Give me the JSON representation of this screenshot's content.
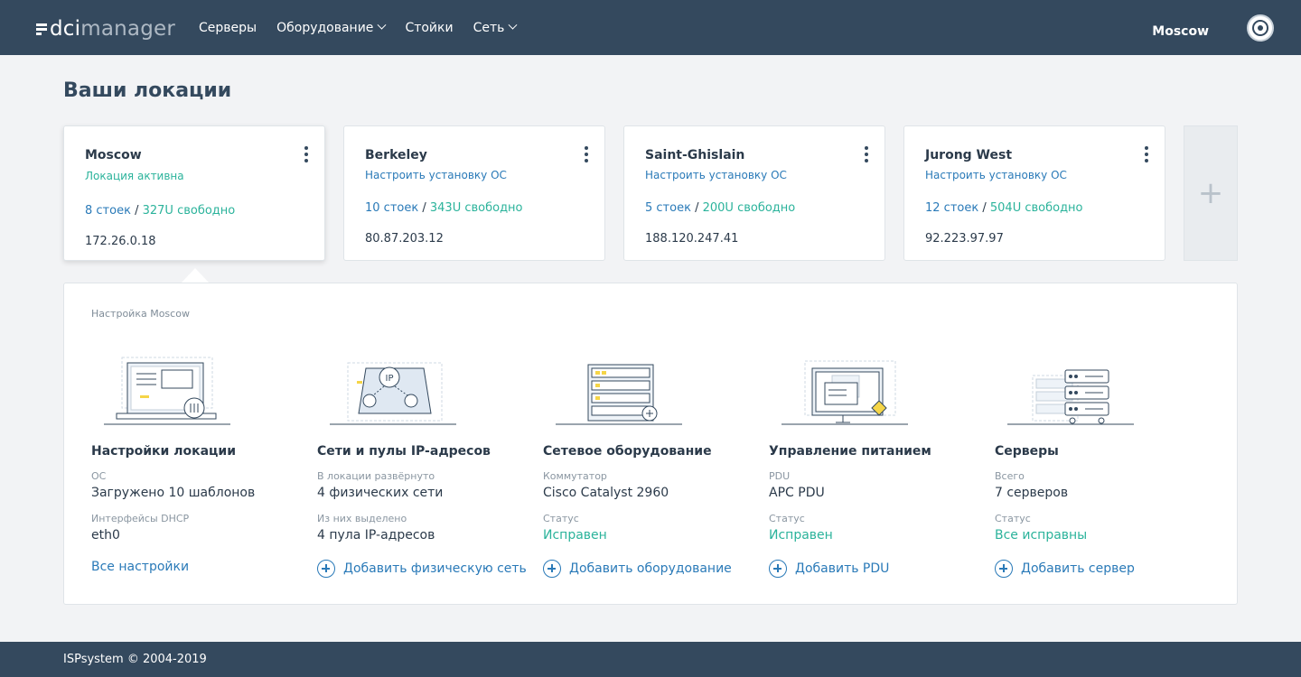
{
  "header": {
    "logo_left": "dci",
    "logo_right": "manager",
    "nav": [
      {
        "label": "Серверы",
        "dropdown": false
      },
      {
        "label": "Оборудование",
        "dropdown": true
      },
      {
        "label": "Стойки",
        "dropdown": false
      },
      {
        "label": "Сеть",
        "dropdown": true
      }
    ],
    "user": "Moscow"
  },
  "page_title": "Ваши локации",
  "locations": [
    {
      "name": "Moscow",
      "status": "Локация активна",
      "racks": "8 стоек",
      "sep": "/",
      "free": "327U свободно",
      "ip": "172.26.0.18"
    },
    {
      "name": "Berkeley",
      "status": "Настроить установку ОС",
      "racks": "10 стоек",
      "sep": "/",
      "free": "343U свободно",
      "ip": "80.87.203.12"
    },
    {
      "name": "Saint-Ghislain",
      "status": "Настроить установку ОС",
      "racks": "5 стоек",
      "sep": "/",
      "free": "200U свободно",
      "ip": "188.120.247.41"
    },
    {
      "name": "Jurong West",
      "status": "Настроить установку ОС",
      "racks": "12 стоек",
      "sep": "/",
      "free": "504U свободно",
      "ip": "92.223.97.97"
    }
  ],
  "add_location": "+",
  "panel": {
    "caption": "Настройка Moscow",
    "columns": [
      {
        "title": "Настройки локации",
        "l1": "ОС",
        "v1": "Загружено 10 шаблонов",
        "l2": "Интерфейсы DHCP",
        "v2": "eth0",
        "action": "Все настройки"
      },
      {
        "title": "Сети и пулы IP-адресов",
        "l1": "В локации развёрнуто",
        "v1": "4 физических сети",
        "l2": "Из них выделено",
        "v2": "4 пула IP-адресов",
        "action": "Добавить физическую сеть"
      },
      {
        "title": "Сетевое оборудование",
        "l1": "Коммутатор",
        "v1": "Cisco Catalyst 2960",
        "l2": "Статус",
        "v2": "Исправен",
        "action": "Добавить оборудование"
      },
      {
        "title": "Управление питанием",
        "l1": "PDU",
        "v1": "APC PDU",
        "l2": "Статус",
        "v2": "Исправен",
        "action": "Добавить PDU"
      },
      {
        "title": "Серверы",
        "l1": "Всего",
        "v1": "7 серверов",
        "l2": "Статус",
        "v2": "Все исправны",
        "action": "Добавить сервер"
      }
    ],
    "illus_ip_label": "IP"
  },
  "footer": "ISPsystem © 2004-2019",
  "colors": {
    "header": "#34495e",
    "link": "#2a7ab8",
    "ok": "#2bb39b"
  }
}
